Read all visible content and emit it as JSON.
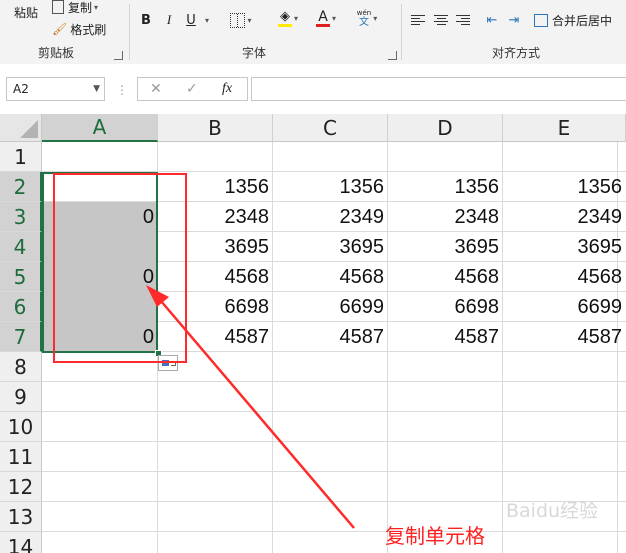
{
  "ribbon": {
    "clipboard": {
      "paste_label": "粘贴",
      "copy_label": "复制",
      "format_painter_label": "格式刷",
      "group_label": "剪贴板"
    },
    "font": {
      "bold": "B",
      "italic": "I",
      "underline": "U",
      "font_color_glyph": "A",
      "phonetic_top": "wén",
      "phonetic_bottom": "文",
      "group_label": "字体"
    },
    "alignment": {
      "merge_center_label": "合并后居中",
      "group_label": "对齐方式"
    }
  },
  "formula_bar": {
    "name_box": "A2",
    "cancel_glyph": "✕",
    "enter_glyph": "✓",
    "fx_glyph": "fx",
    "value": ""
  },
  "sheet": {
    "columns": [
      "A",
      "B",
      "C",
      "D",
      "E"
    ],
    "selected_column": "A",
    "rows": [
      {
        "num": "1",
        "cells": [
          "",
          "",
          "",
          "",
          ""
        ]
      },
      {
        "num": "2",
        "cells": [
          "",
          "1356",
          "1356",
          "1356",
          "1356"
        ]
      },
      {
        "num": "3",
        "cells": [
          "0",
          "2348",
          "2349",
          "2348",
          "2349"
        ]
      },
      {
        "num": "4",
        "cells": [
          "",
          "3695",
          "3695",
          "3695",
          "3695"
        ]
      },
      {
        "num": "5",
        "cells": [
          "0",
          "4568",
          "4568",
          "4568",
          "4568"
        ]
      },
      {
        "num": "6",
        "cells": [
          "",
          "6698",
          "6699",
          "6698",
          "6699"
        ]
      },
      {
        "num": "7",
        "cells": [
          "0",
          "4587",
          "4587",
          "4587",
          "4587"
        ]
      },
      {
        "num": "8",
        "cells": [
          "",
          "",
          "",
          "",
          ""
        ]
      },
      {
        "num": "9",
        "cells": [
          "",
          "",
          "",
          "",
          ""
        ]
      },
      {
        "num": "10",
        "cells": [
          "",
          "",
          "",
          "",
          ""
        ]
      },
      {
        "num": "11",
        "cells": [
          "",
          "",
          "",
          "",
          ""
        ]
      },
      {
        "num": "12",
        "cells": [
          "",
          "",
          "",
          "",
          ""
        ]
      },
      {
        "num": "13",
        "cells": [
          "",
          "",
          "",
          "",
          ""
        ]
      },
      {
        "num": "14",
        "cells": [
          "",
          "",
          "",
          "",
          ""
        ]
      }
    ]
  },
  "annotation": {
    "label": "复制单元格",
    "color": "#ff2020"
  },
  "watermark": "Baidu经验",
  "colors": {
    "accent": "#217346",
    "annotation": "#ff2a2a",
    "selection_fill": "#c6c6c6"
  }
}
